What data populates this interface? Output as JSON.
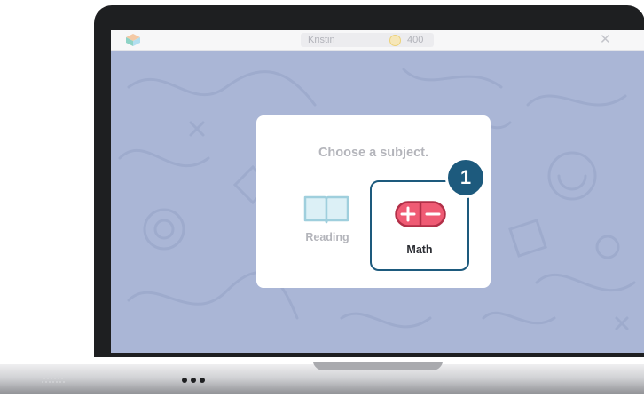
{
  "app": {
    "user_name": "Kristin",
    "coins": "400"
  },
  "dialog": {
    "title": "Choose a subject.",
    "subjects": [
      {
        "label": "Reading",
        "icon": "book-icon",
        "selected": false
      },
      {
        "label": "Math",
        "icon": "plus-minus-icon",
        "selected": true
      }
    ]
  },
  "callout": {
    "step": "1"
  },
  "colors": {
    "screen_background": "#aab6d6",
    "highlight": "#1d5a7d",
    "math_icon": "#ef5b74",
    "book_icon": "#c7e4ee",
    "coin": "#f6e7b9"
  }
}
